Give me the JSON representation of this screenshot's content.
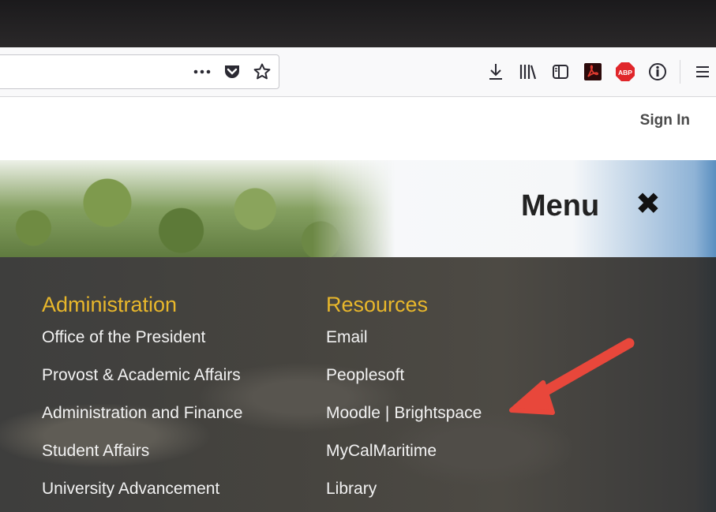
{
  "browser": {
    "url_actions": {
      "more_icon": "more-icon",
      "pocket_icon": "pocket-icon",
      "bookmark_icon": "star-icon"
    },
    "toolbar_icons": [
      "download-icon",
      "library-icon",
      "sidebar-icon",
      "pdf-icon",
      "adblock-icon",
      "info-icon",
      "hamburger-menu-icon"
    ]
  },
  "header": {
    "sign_in": "Sign In",
    "menu_label": "Menu",
    "close_symbol": "✖"
  },
  "menu": {
    "administration": {
      "title": "Administration",
      "items": [
        "Office of the President",
        "Provost & Academic Affairs",
        "Administration and Finance",
        "Student Affairs",
        "University Advancement"
      ]
    },
    "resources": {
      "title": "Resources",
      "items": [
        "Email",
        "Peoplesoft",
        "MyCalMaritime",
        "Library"
      ],
      "moodle": "Moodle",
      "brightspace": "Brightspace",
      "divider": "|"
    }
  },
  "colors": {
    "heading": "#e8b72b",
    "link": "#f2f2f2",
    "arrow": "#e8473b",
    "panel": "#45433f"
  }
}
